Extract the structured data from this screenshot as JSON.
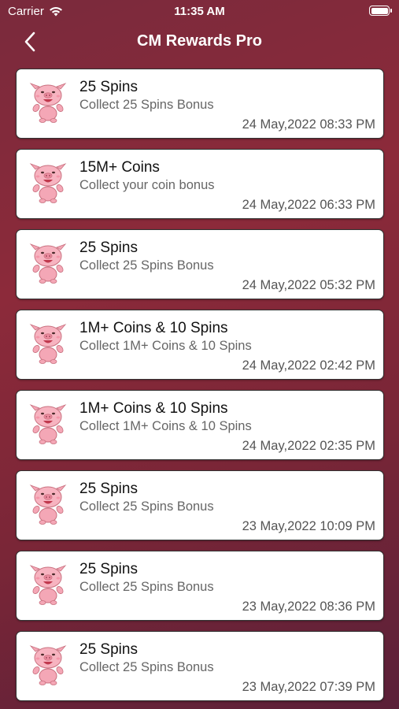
{
  "status_bar": {
    "carrier": "Carrier",
    "time": "11:35 AM"
  },
  "nav": {
    "title": "CM Rewards Pro"
  },
  "rewards": [
    {
      "title": "25 Spins",
      "subtitle": "Collect 25 Spins Bonus",
      "timestamp": "24 May,2022 08:33 PM"
    },
    {
      "title": "15M+ Coins",
      "subtitle": "Collect your coin bonus",
      "timestamp": "24 May,2022 06:33 PM"
    },
    {
      "title": "25 Spins",
      "subtitle": "Collect 25 Spins Bonus",
      "timestamp": "24 May,2022 05:32 PM"
    },
    {
      "title": "1M+ Coins & 10 Spins",
      "subtitle": "Collect 1M+ Coins & 10 Spins",
      "timestamp": "24 May,2022 02:42 PM"
    },
    {
      "title": "1M+ Coins & 10 Spins",
      "subtitle": "Collect 1M+ Coins & 10 Spins",
      "timestamp": "24 May,2022 02:35 PM"
    },
    {
      "title": "25 Spins",
      "subtitle": "Collect 25 Spins Bonus",
      "timestamp": "23 May,2022 10:09 PM"
    },
    {
      "title": "25 Spins",
      "subtitle": "Collect 25 Spins Bonus",
      "timestamp": "23 May,2022 08:36 PM"
    },
    {
      "title": "25 Spins",
      "subtitle": "Collect 25 Spins Bonus",
      "timestamp": "23 May,2022 07:39 PM"
    }
  ],
  "icons": {
    "reward": "pig-icon",
    "back": "chevron-left-icon",
    "wifi": "wifi-icon",
    "battery": "battery-icon"
  },
  "colors": {
    "background": "#8c2a3a",
    "card": "#ffffff",
    "title_text": "#111111",
    "subtitle_text": "#666666"
  }
}
